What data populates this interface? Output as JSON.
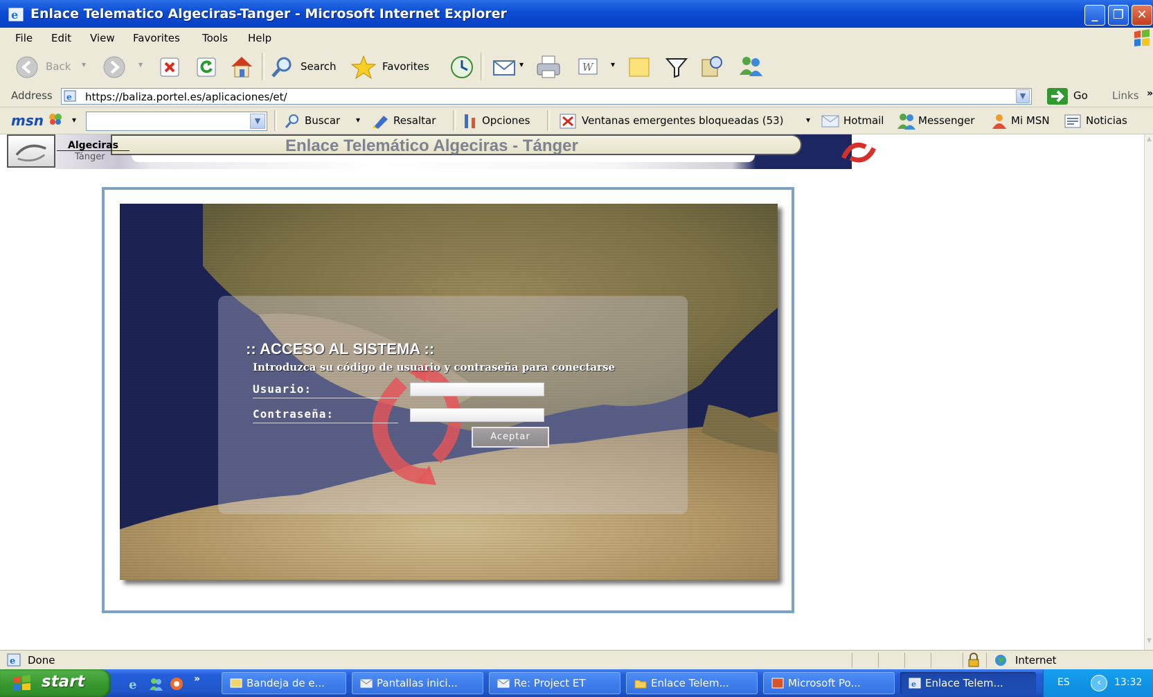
{
  "window": {
    "title": "Enlace Telematico Algeciras-Tanger - Microsoft Internet Explorer",
    "controls": {
      "minimize": "_",
      "restore": "❐",
      "close": "✕"
    }
  },
  "menubar": {
    "items": [
      "File",
      "Edit",
      "View",
      "Favorites",
      "Tools",
      "Help"
    ]
  },
  "toolbar": {
    "back_label": "Back",
    "search_label": "Search",
    "favorites_label": "Favorites"
  },
  "address": {
    "label": "Address",
    "url": "https://baliza.portel.es/aplicaciones/et/",
    "go_label": "Go",
    "links_label": "Links"
  },
  "msn": {
    "logo": "msn",
    "search_value": "",
    "buscar_label": "Buscar",
    "resaltar_label": "Resaltar",
    "opciones_label": "Opciones",
    "popups_label": "Ventanas emergentes bloqueadas (53)",
    "hotmail_label": "Hotmail",
    "messenger_label": "Messenger",
    "mimsn_label": "Mi MSN",
    "noticias_label": "Noticias"
  },
  "banner": {
    "logo_line1": "Algeciras",
    "logo_line2": "Tánger",
    "title": "Enlace Telemático Algeciras - Tánger"
  },
  "login": {
    "heading": ":: ACCESO AL SISTEMA ::",
    "instructions": "Introduzca su código de usuario y contraseña para conectarse",
    "user_label": "Usuario:",
    "user_value": "",
    "password_label": "Contraseña:",
    "password_value": "",
    "submit_label": "Aceptar"
  },
  "status": {
    "text": "Done",
    "zone": "Internet"
  },
  "taskbar": {
    "start_label": "start",
    "tasks": [
      "Bandeja de e...",
      "Pantallas inici...",
      "Re: Project ET",
      "Enlace Telem...",
      "Microsoft Po...",
      "Enlace Telem..."
    ],
    "active_task_index": 5,
    "language": "ES",
    "clock": "13:32"
  },
  "colors": {
    "titlebar": "#0b4bd3",
    "chrome": "#ece9d8",
    "frame_border": "#7ba1c4",
    "start_green": "#3a9a31",
    "taskbar_blue": "#245edb"
  }
}
